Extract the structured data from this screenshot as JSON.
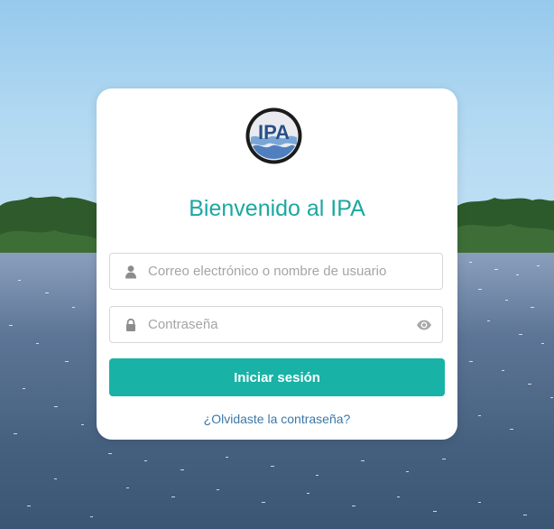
{
  "login": {
    "logo_text": "IPA",
    "title": "Bienvenido al IPA",
    "email": {
      "placeholder": "Correo electrónico o nombre de usuario",
      "value": ""
    },
    "password": {
      "placeholder": "Contraseña",
      "value": ""
    },
    "submit_label": "Iniciar sesión",
    "forgot_label": "¿Olvidaste la contraseña?"
  },
  "icons": {
    "email_field": "user-icon",
    "password_field": "lock-icon",
    "password_toggle": "eye-icon"
  },
  "colors": {
    "accent": "#18b2a6",
    "title": "#1ba8a0",
    "link": "#3c78a8",
    "card": "#ffffff",
    "logo_ring": "#1b1b1b",
    "logo_text": "#2a4f86"
  }
}
